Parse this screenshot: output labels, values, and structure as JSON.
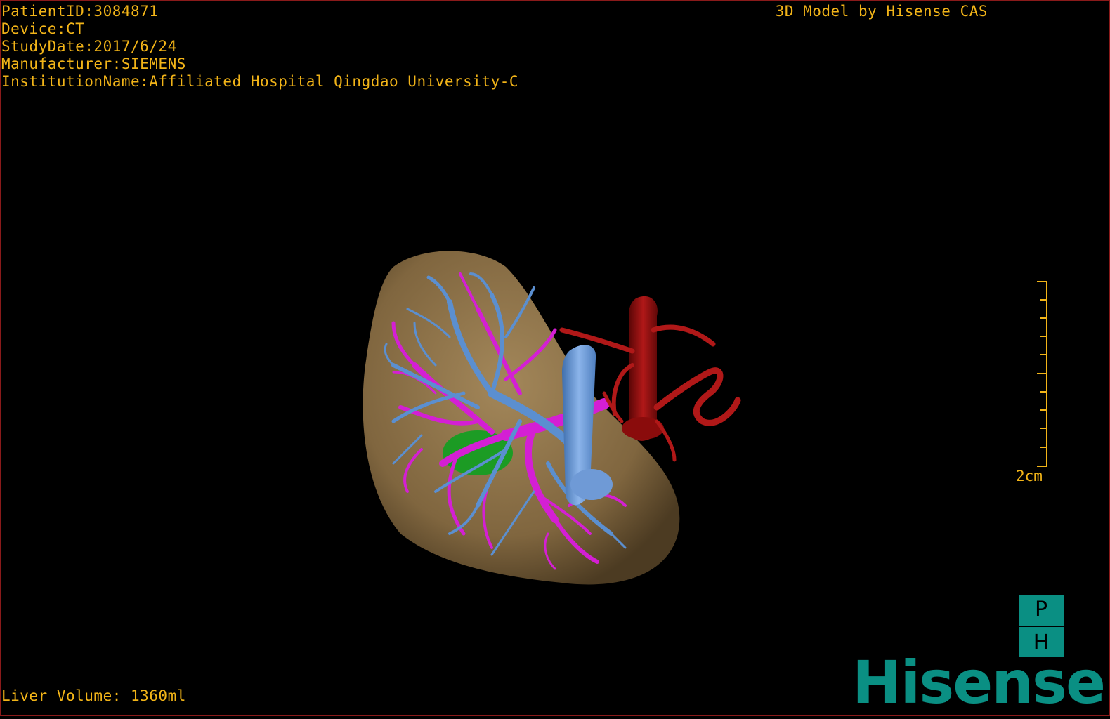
{
  "header": {
    "patient_id": "PatientID:3084871",
    "device": "Device:CT",
    "study_date": "StudyDate:2017/6/24",
    "manufacturer": "Manufacturer:SIEMENS",
    "institution": "InstitutionName:Affiliated Hospital Qingdao University-C"
  },
  "credit": "3D Model by Hisense CAS",
  "footer": {
    "liver_volume": "Liver Volume: 1360ml"
  },
  "scale": {
    "label": "2cm"
  },
  "badge": {
    "top": "P",
    "bottom": "H"
  },
  "brand": "Hisense",
  "colors": {
    "overlay_text": "#f2b418",
    "liver": "#8b7148",
    "portal_vein": "#5b8fd0",
    "hepatic_vein": "#d41fd4",
    "artery": "#a01010",
    "lesion": "#10a020",
    "brand": "#0a8f83"
  }
}
